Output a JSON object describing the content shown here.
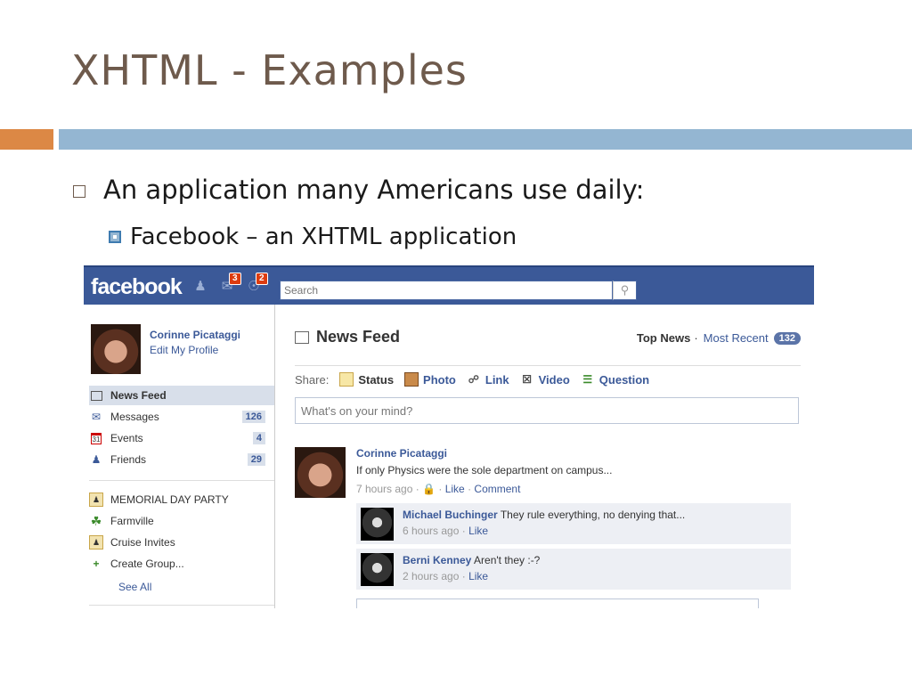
{
  "slide": {
    "title": "XHTML - Examples",
    "bullet1": "An application many Americans use daily:",
    "bullet2": "Facebook – an XHTML application"
  },
  "colors": {
    "accent_orange": "#dc8845",
    "accent_blue": "#94b6d2",
    "fb_blue": "#3b5998",
    "title_brown": "#6e5a4c"
  },
  "facebook": {
    "logo": "facebook",
    "jewels": {
      "friends_icon": "friends-icon",
      "messages_count": "3",
      "notifications_count": "2"
    },
    "search": {
      "placeholder": "Search"
    },
    "profile": {
      "name": "Corinne Picataggi",
      "edit_link": "Edit My Profile"
    },
    "nav": [
      {
        "label": "News Feed",
        "icon": "news-feed-icon",
        "count": ""
      },
      {
        "label": "Messages",
        "icon": "messages-icon",
        "count": "126"
      },
      {
        "label": "Events",
        "icon": "events-icon",
        "count": "4",
        "icon_text": "31"
      },
      {
        "label": "Friends",
        "icon": "friends-icon",
        "count": "29"
      }
    ],
    "groups": [
      {
        "label": "MEMORIAL DAY PARTY",
        "icon": "group-icon"
      },
      {
        "label": "Farmville",
        "icon": "tree-icon"
      },
      {
        "label": "Cruise Invites",
        "icon": "group-icon"
      },
      {
        "label": "Create Group...",
        "icon": "create-group-icon"
      }
    ],
    "see_all": "See All",
    "feed": {
      "title": "News Feed",
      "top_news": "Top News",
      "separator": "·",
      "most_recent": "Most Recent",
      "most_recent_count": "132",
      "share_label": "Share:",
      "share_items": [
        "Status",
        "Photo",
        "Link",
        "Video",
        "Question"
      ],
      "composer_placeholder": "What's on your mind?",
      "post": {
        "author": "Corinne Picataggi",
        "text": "If only Physics were the sole department on campus...",
        "time": "7 hours ago",
        "dot": "·",
        "like": "Like",
        "comment": "Comment"
      },
      "comments": [
        {
          "author": "Michael Buchinger",
          "text": "They rule everything, no denying that...",
          "time": "6 hours ago",
          "like": "Like"
        },
        {
          "author": "Berni Kenney",
          "text": "Aren't they :-?",
          "time": "2 hours ago",
          "like": "Like"
        }
      ]
    }
  }
}
